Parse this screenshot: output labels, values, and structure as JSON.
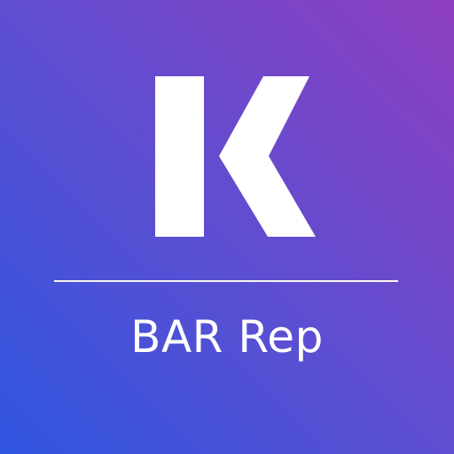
{
  "icon": {
    "label": "BAR Rep",
    "logo_icon": "letter-k-logo-icon",
    "colors": {
      "gradient_start": "#2f55e0",
      "gradient_mid": "#5a4fd2",
      "gradient_end": "#8e3ec0",
      "foreground": "#ffffff"
    }
  }
}
